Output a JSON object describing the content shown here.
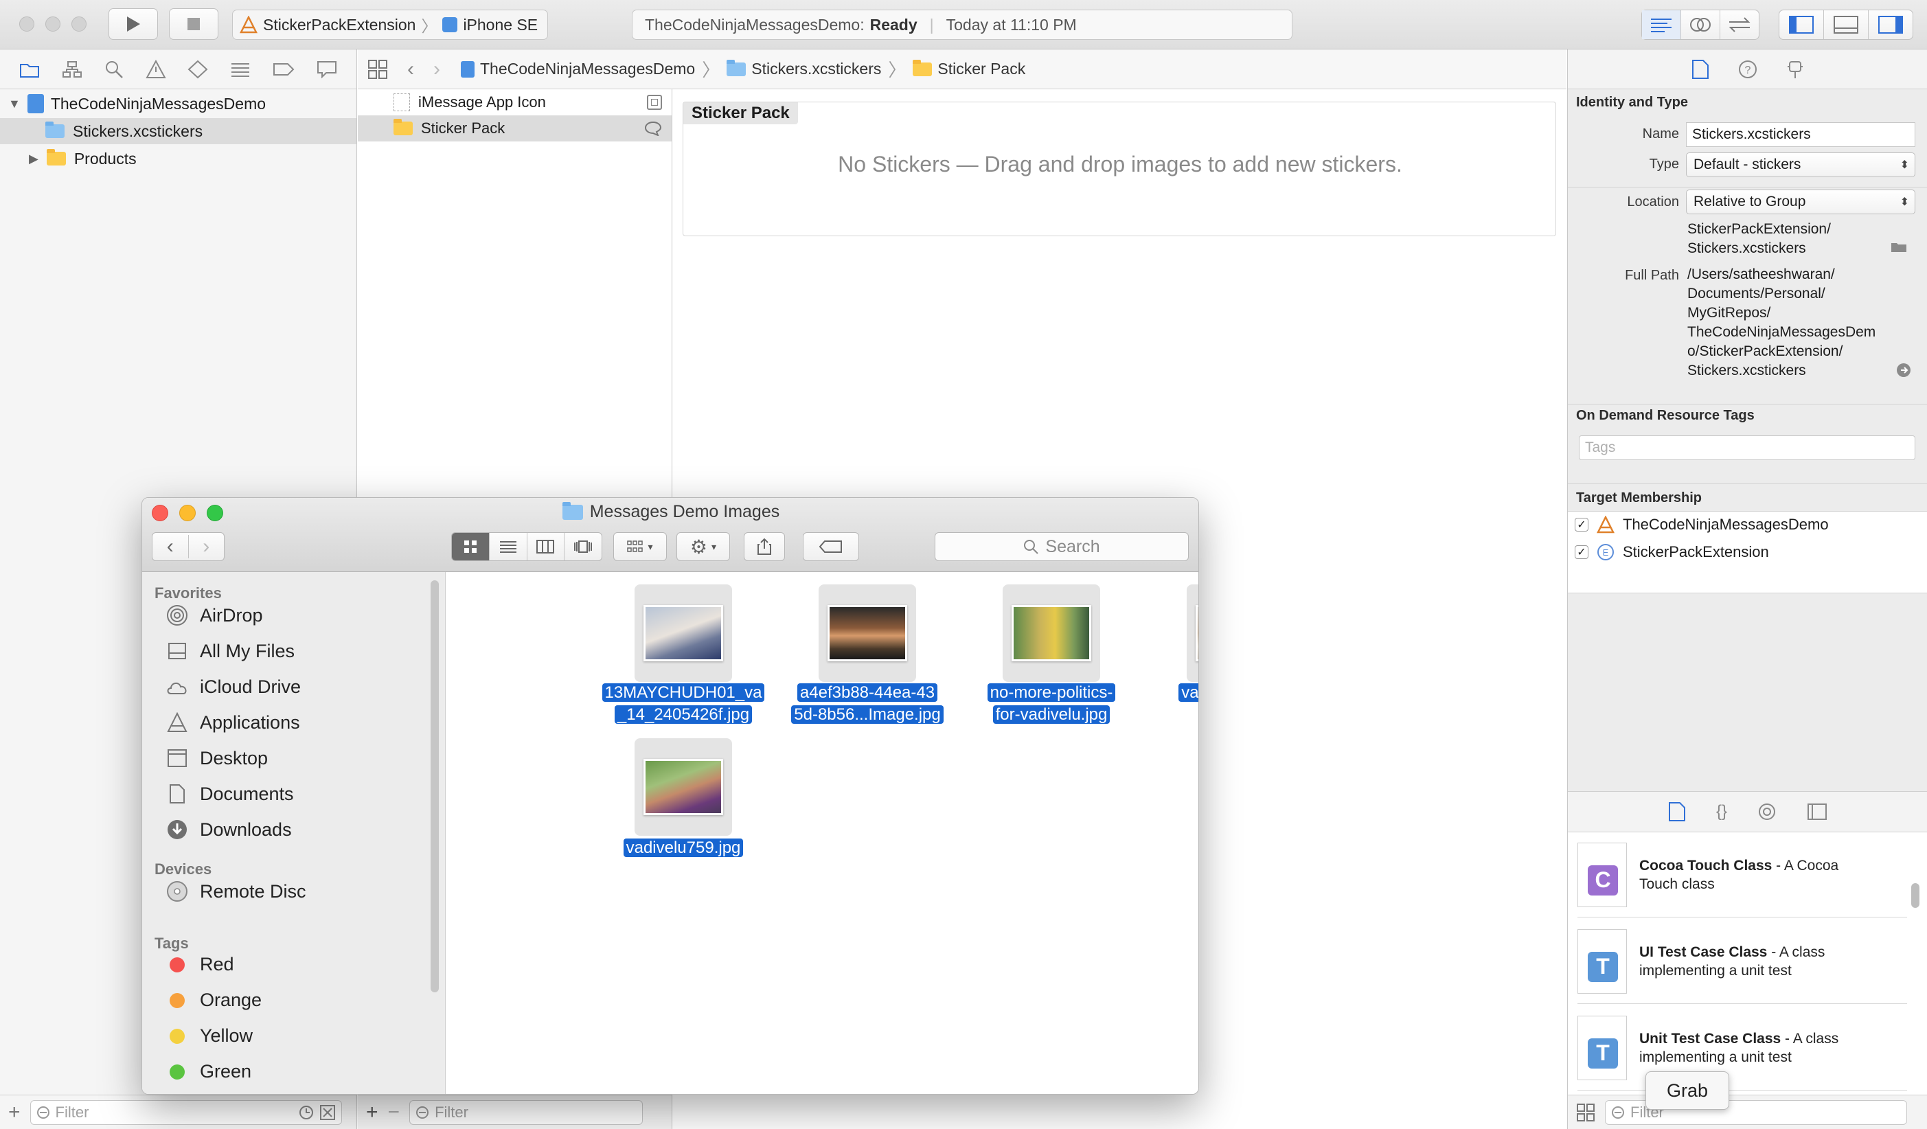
{
  "toolbar": {
    "scheme_target": "StickerPackExtension",
    "scheme_device": "iPhone SE",
    "activity_project": "TheCodeNinjaMessagesDemo:",
    "activity_status": "Ready",
    "activity_time": "Today at 11:10 PM"
  },
  "navigator": {
    "project": "TheCodeNinjaMessagesDemo",
    "items": [
      "Stickers.xcstickers",
      "Products"
    ],
    "filter_placeholder": "Filter"
  },
  "jumpbar": {
    "crumbs": [
      "TheCodeNinjaMessagesDemo",
      "Stickers.xcstickers",
      "Sticker Pack"
    ]
  },
  "assets": {
    "items": [
      "iMessage App Icon",
      "Sticker Pack"
    ],
    "filter_placeholder": "Filter"
  },
  "canvas": {
    "pack_title": "Sticker Pack",
    "empty_message": "No Stickers — Drag and drop images to add new stickers."
  },
  "inspector": {
    "identity_header": "Identity and Type",
    "name_label": "Name",
    "name_value": "Stickers.xcstickers",
    "type_label": "Type",
    "type_value": "Default - stickers",
    "location_label": "Location",
    "location_value": "Relative to Group",
    "location_path": [
      "StickerPackExtension/",
      "Stickers.xcstickers"
    ],
    "fullpath_label": "Full Path",
    "fullpath_lines": [
      "/Users/satheeshwaran/",
      "Documents/Personal/",
      "MyGitRepos/",
      "TheCodeNinjaMessagesDem",
      "o/StickerPackExtension/",
      "Stickers.xcstickers"
    ],
    "odr_header": "On Demand Resource Tags",
    "tags_placeholder": "Tags",
    "membership_header": "Target Membership",
    "targets": [
      "TheCodeNinjaMessagesDemo",
      "StickerPackExtension"
    ],
    "library": [
      {
        "title": "Cocoa Touch Class",
        "desc_1": " - A Cocoa",
        "desc_2": "Touch class",
        "letter": "C"
      },
      {
        "title": "UI Test Case Class",
        "desc_1": " - A class",
        "desc_2": "implementing a unit test",
        "letter": "T"
      },
      {
        "title": "Unit Test Case Class",
        "desc_1": " - A class",
        "desc_2": "implementing a unit test",
        "letter": "T"
      }
    ],
    "filter_placeholder": "Filter"
  },
  "tooltip": "Grab",
  "finder": {
    "title": "Messages Demo Images",
    "search_placeholder": "Search",
    "favorites_header": "Favorites",
    "favorites": [
      "AirDrop",
      "All My Files",
      "iCloud Drive",
      "Applications",
      "Desktop",
      "Documents",
      "Downloads"
    ],
    "devices_header": "Devices",
    "devices": [
      "Remote Disc"
    ],
    "tags_header": "Tags",
    "tags": [
      {
        "name": "Red",
        "color": "#f5524f"
      },
      {
        "name": "Orange",
        "color": "#f7a03c"
      },
      {
        "name": "Yellow",
        "color": "#f4d03f"
      },
      {
        "name": "Green",
        "color": "#5ac440"
      }
    ],
    "files": [
      {
        "line1": "13MAYCHUDH01_va",
        "line2": "_14_2405426f.jpg"
      },
      {
        "line1": "a4ef3b88-44ea-43",
        "line2": "5d-8b56...Image.jpg"
      },
      {
        "line1": "no-more-politics-",
        "line2": "for-vadivelu.jpg"
      },
      {
        "line1": "vadifeature.jpg",
        "line2": ""
      },
      {
        "line1": "vadivelu759.jpg",
        "line2": ""
      }
    ]
  }
}
